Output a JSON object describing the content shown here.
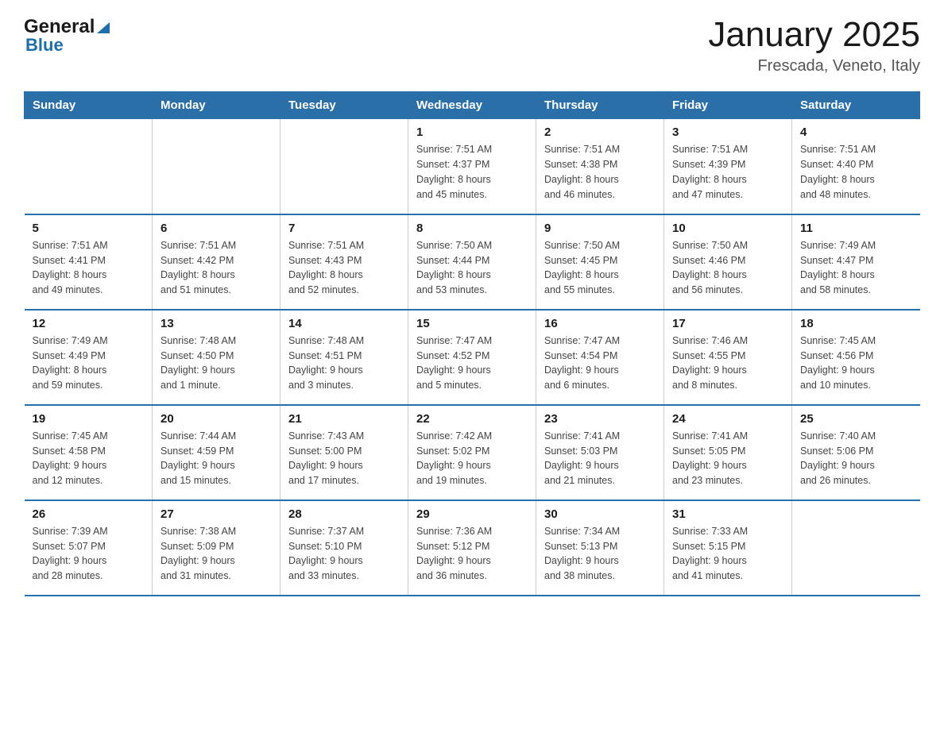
{
  "header": {
    "logo_general": "General",
    "logo_blue": "Blue",
    "title": "January 2025",
    "subtitle": "Frescada, Veneto, Italy"
  },
  "days_of_week": [
    "Sunday",
    "Monday",
    "Tuesday",
    "Wednesday",
    "Thursday",
    "Friday",
    "Saturday"
  ],
  "weeks": [
    [
      {
        "day": "",
        "info": ""
      },
      {
        "day": "",
        "info": ""
      },
      {
        "day": "",
        "info": ""
      },
      {
        "day": "1",
        "info": "Sunrise: 7:51 AM\nSunset: 4:37 PM\nDaylight: 8 hours\nand 45 minutes."
      },
      {
        "day": "2",
        "info": "Sunrise: 7:51 AM\nSunset: 4:38 PM\nDaylight: 8 hours\nand 46 minutes."
      },
      {
        "day": "3",
        "info": "Sunrise: 7:51 AM\nSunset: 4:39 PM\nDaylight: 8 hours\nand 47 minutes."
      },
      {
        "day": "4",
        "info": "Sunrise: 7:51 AM\nSunset: 4:40 PM\nDaylight: 8 hours\nand 48 minutes."
      }
    ],
    [
      {
        "day": "5",
        "info": "Sunrise: 7:51 AM\nSunset: 4:41 PM\nDaylight: 8 hours\nand 49 minutes."
      },
      {
        "day": "6",
        "info": "Sunrise: 7:51 AM\nSunset: 4:42 PM\nDaylight: 8 hours\nand 51 minutes."
      },
      {
        "day": "7",
        "info": "Sunrise: 7:51 AM\nSunset: 4:43 PM\nDaylight: 8 hours\nand 52 minutes."
      },
      {
        "day": "8",
        "info": "Sunrise: 7:50 AM\nSunset: 4:44 PM\nDaylight: 8 hours\nand 53 minutes."
      },
      {
        "day": "9",
        "info": "Sunrise: 7:50 AM\nSunset: 4:45 PM\nDaylight: 8 hours\nand 55 minutes."
      },
      {
        "day": "10",
        "info": "Sunrise: 7:50 AM\nSunset: 4:46 PM\nDaylight: 8 hours\nand 56 minutes."
      },
      {
        "day": "11",
        "info": "Sunrise: 7:49 AM\nSunset: 4:47 PM\nDaylight: 8 hours\nand 58 minutes."
      }
    ],
    [
      {
        "day": "12",
        "info": "Sunrise: 7:49 AM\nSunset: 4:49 PM\nDaylight: 8 hours\nand 59 minutes."
      },
      {
        "day": "13",
        "info": "Sunrise: 7:48 AM\nSunset: 4:50 PM\nDaylight: 9 hours\nand 1 minute."
      },
      {
        "day": "14",
        "info": "Sunrise: 7:48 AM\nSunset: 4:51 PM\nDaylight: 9 hours\nand 3 minutes."
      },
      {
        "day": "15",
        "info": "Sunrise: 7:47 AM\nSunset: 4:52 PM\nDaylight: 9 hours\nand 5 minutes."
      },
      {
        "day": "16",
        "info": "Sunrise: 7:47 AM\nSunset: 4:54 PM\nDaylight: 9 hours\nand 6 minutes."
      },
      {
        "day": "17",
        "info": "Sunrise: 7:46 AM\nSunset: 4:55 PM\nDaylight: 9 hours\nand 8 minutes."
      },
      {
        "day": "18",
        "info": "Sunrise: 7:45 AM\nSunset: 4:56 PM\nDaylight: 9 hours\nand 10 minutes."
      }
    ],
    [
      {
        "day": "19",
        "info": "Sunrise: 7:45 AM\nSunset: 4:58 PM\nDaylight: 9 hours\nand 12 minutes."
      },
      {
        "day": "20",
        "info": "Sunrise: 7:44 AM\nSunset: 4:59 PM\nDaylight: 9 hours\nand 15 minutes."
      },
      {
        "day": "21",
        "info": "Sunrise: 7:43 AM\nSunset: 5:00 PM\nDaylight: 9 hours\nand 17 minutes."
      },
      {
        "day": "22",
        "info": "Sunrise: 7:42 AM\nSunset: 5:02 PM\nDaylight: 9 hours\nand 19 minutes."
      },
      {
        "day": "23",
        "info": "Sunrise: 7:41 AM\nSunset: 5:03 PM\nDaylight: 9 hours\nand 21 minutes."
      },
      {
        "day": "24",
        "info": "Sunrise: 7:41 AM\nSunset: 5:05 PM\nDaylight: 9 hours\nand 23 minutes."
      },
      {
        "day": "25",
        "info": "Sunrise: 7:40 AM\nSunset: 5:06 PM\nDaylight: 9 hours\nand 26 minutes."
      }
    ],
    [
      {
        "day": "26",
        "info": "Sunrise: 7:39 AM\nSunset: 5:07 PM\nDaylight: 9 hours\nand 28 minutes."
      },
      {
        "day": "27",
        "info": "Sunrise: 7:38 AM\nSunset: 5:09 PM\nDaylight: 9 hours\nand 31 minutes."
      },
      {
        "day": "28",
        "info": "Sunrise: 7:37 AM\nSunset: 5:10 PM\nDaylight: 9 hours\nand 33 minutes."
      },
      {
        "day": "29",
        "info": "Sunrise: 7:36 AM\nSunset: 5:12 PM\nDaylight: 9 hours\nand 36 minutes."
      },
      {
        "day": "30",
        "info": "Sunrise: 7:34 AM\nSunset: 5:13 PM\nDaylight: 9 hours\nand 38 minutes."
      },
      {
        "day": "31",
        "info": "Sunrise: 7:33 AM\nSunset: 5:15 PM\nDaylight: 9 hours\nand 41 minutes."
      },
      {
        "day": "",
        "info": ""
      }
    ]
  ]
}
